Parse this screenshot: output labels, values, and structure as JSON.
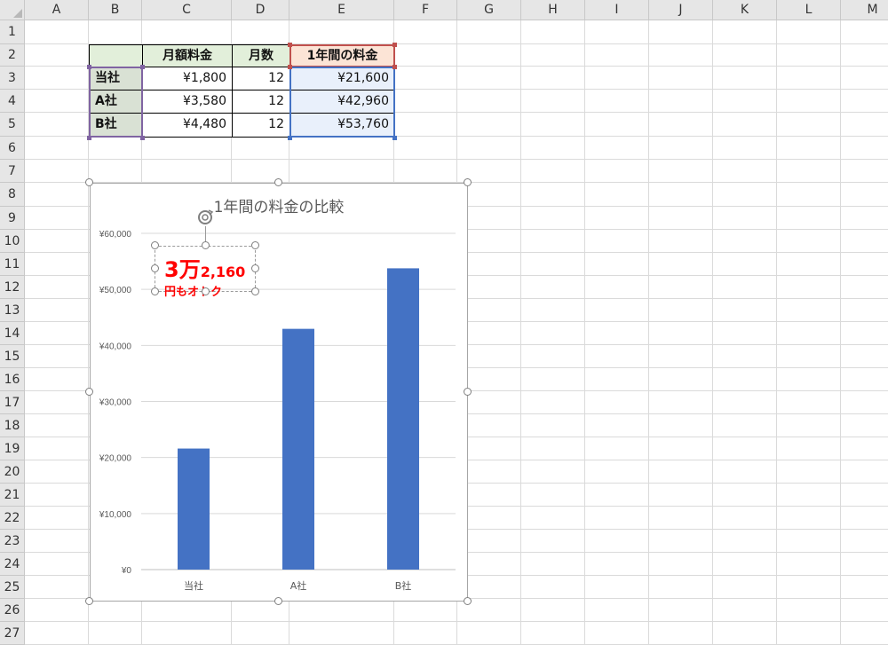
{
  "columns": [
    "A",
    "B",
    "C",
    "D",
    "E",
    "F",
    "G",
    "H",
    "I",
    "J",
    "K",
    "L",
    "M"
  ],
  "rows": [
    "1",
    "2",
    "3",
    "4",
    "5",
    "6",
    "7",
    "8",
    "9",
    "10",
    "11",
    "12",
    "13",
    "14",
    "15",
    "16",
    "17",
    "18",
    "19",
    "20",
    "21",
    "22",
    "23",
    "24",
    "25",
    "26",
    "27"
  ],
  "table": {
    "headers": [
      "",
      "月額料金",
      "月数",
      "1年間の料金"
    ],
    "rows": [
      {
        "company": "当社",
        "monthly": "¥1,800",
        "months": "12",
        "annual": "¥21,600"
      },
      {
        "company": "A社",
        "monthly": "¥3,580",
        "months": "12",
        "annual": "¥42,960"
      },
      {
        "company": "B社",
        "monthly": "¥4,480",
        "months": "12",
        "annual": "¥53,760"
      }
    ]
  },
  "callout": {
    "big": "3万",
    "small": "2,160",
    "sub": "円もオトク"
  },
  "colors": {
    "bar": "#4472c4",
    "callout_text": "#ff0000",
    "header_fill": "#e2efda",
    "selection_red": "#c0504d",
    "selection_blue": "#4472c4",
    "selection_purple": "#8064a2"
  },
  "chart_data": {
    "type": "bar",
    "title": "1年間の料金の比較",
    "categories": [
      "当社",
      "A社",
      "B社"
    ],
    "values": [
      21600,
      42960,
      53760
    ],
    "ylim": [
      0,
      60000
    ],
    "yticks": [
      "¥0",
      "¥10,000",
      "¥20,000",
      "¥30,000",
      "¥40,000",
      "¥50,000",
      "¥60,000"
    ],
    "grid": true,
    "legend": "none"
  }
}
